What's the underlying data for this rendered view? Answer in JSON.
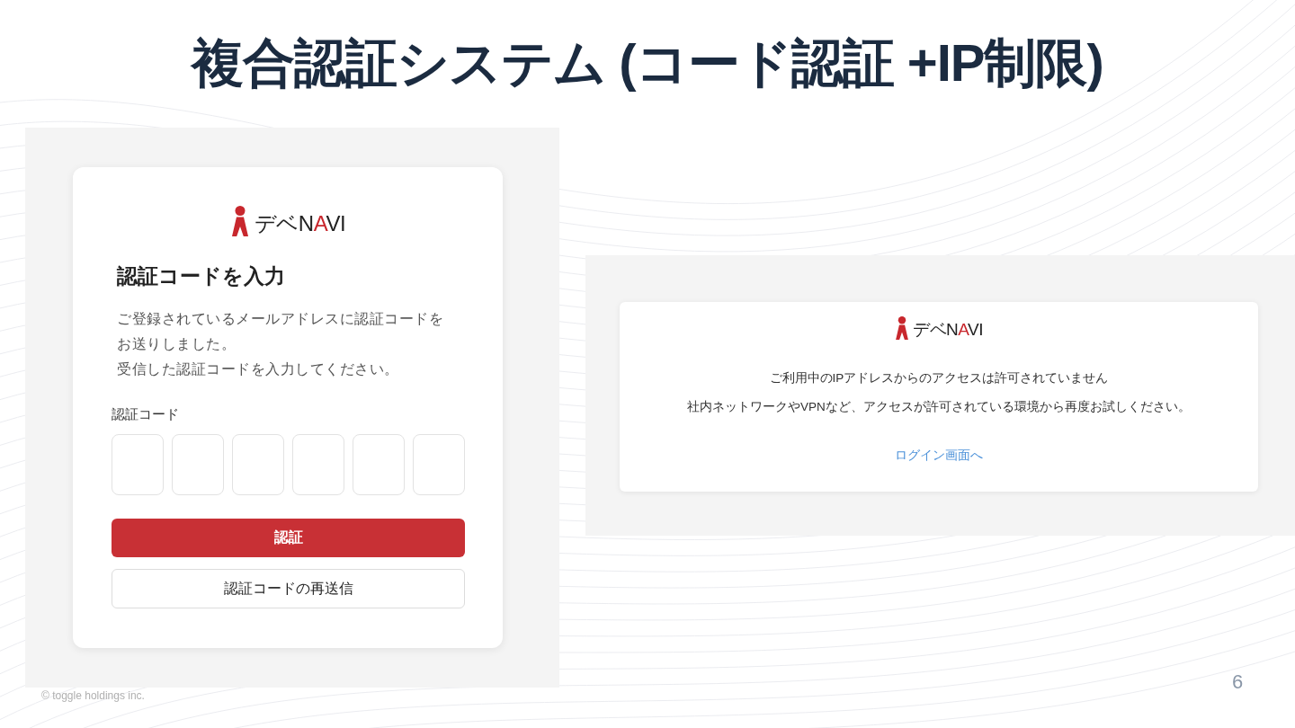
{
  "slide": {
    "title": "複合認証システム (コード認証 +IP制限)",
    "copyright": "© toggle holdings inc.",
    "page_number": "6"
  },
  "screens": [
    {
      "kind": "code_entry",
      "logo": {
        "parts": [
          {
            "text": "デベN",
            "color": "#222222"
          },
          {
            "text": "A",
            "color": "#c8272d"
          },
          {
            "text": "VI",
            "color": "#222222"
          }
        ]
      },
      "heading": "認証コードを入力",
      "description_lines": [
        "ご登録されているメールアドレスに認証コードを",
        "お送りしました。",
        "受信した認証コードを入力してください。"
      ],
      "field_label": "認証コード",
      "code_boxes": [
        {
          "focused": false
        },
        {
          "focused": false
        },
        {
          "focused": false
        },
        {
          "focused": false
        },
        {
          "focused": false
        },
        {
          "focused": false
        }
      ],
      "buttons": [
        {
          "kind": "primary",
          "label": "認証"
        },
        {
          "kind": "secondary",
          "label": "認証コードの再送信"
        }
      ]
    },
    {
      "kind": "ip_blocked",
      "logo": {
        "parts": [
          {
            "text": "デベN",
            "color": "#222222"
          },
          {
            "text": "A",
            "color": "#c8272d"
          },
          {
            "text": "VI",
            "color": "#222222"
          }
        ]
      },
      "messages": [
        "ご利用中のIPアドレスからのアクセスは許可されていません",
        "社内ネットワークやVPNなど、アクセスが許可されている環境から再度お試しください。"
      ],
      "link": "ログイン画面へ"
    }
  ]
}
